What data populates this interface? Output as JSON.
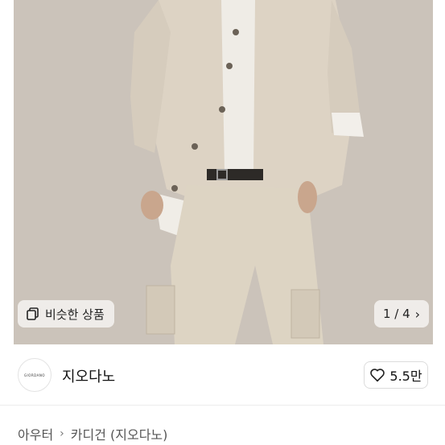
{
  "gallery": {
    "similar_label": "비슷한 상품",
    "pager": "1 / 4",
    "similar_icon": "copy-icon",
    "next_icon": "chevron-right-icon"
  },
  "seller": {
    "logo_text": "GIORDANO",
    "name": "지오다노"
  },
  "like": {
    "count": "5.5만",
    "icon": "heart-icon"
  },
  "breadcrumb": {
    "items": [
      "아우터",
      "카디건 (지오다노)"
    ]
  }
}
